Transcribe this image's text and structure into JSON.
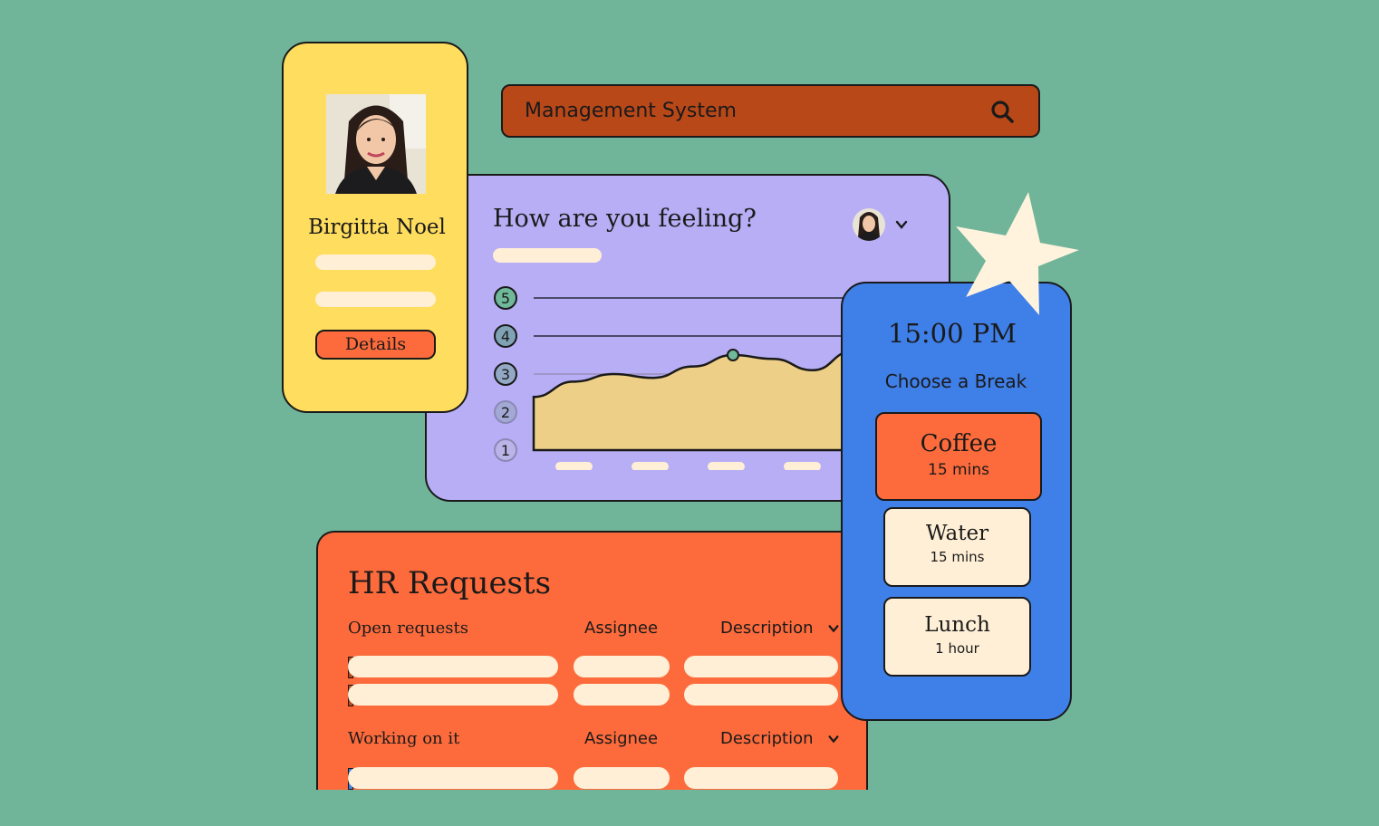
{
  "profile": {
    "name": "Birgitta Noel",
    "details_label": "Details"
  },
  "search": {
    "text": "Management System",
    "icon": "search-icon"
  },
  "mood": {
    "title": "How are you feeling?",
    "scale": [
      "5",
      "4",
      "3",
      "2",
      "1"
    ],
    "chart_data": {
      "type": "area",
      "ylim": [
        1,
        5
      ],
      "values": [
        2.4,
        2.8,
        3.0,
        2.9,
        3.2,
        3.5,
        3.4,
        3.1,
        3.6
      ],
      "highlight_value": 3.5,
      "ticks": 5
    }
  },
  "break": {
    "time": "15:00 PM",
    "subtitle": "Choose a Break",
    "options": [
      {
        "title": "Coffee",
        "duration": "15 mins",
        "selected": true
      },
      {
        "title": "Water",
        "duration": "15 mins",
        "selected": false
      },
      {
        "title": "Lunch",
        "duration": "1 hour",
        "selected": false
      }
    ]
  },
  "hr": {
    "title": "HR Requests",
    "sections": [
      {
        "label": "Open requests",
        "assignee": "Assignee",
        "description": "Description"
      },
      {
        "label": "Working on it",
        "assignee": "Assignee",
        "description": "Description"
      }
    ]
  },
  "colors": {
    "background": "#70b499",
    "profile": "#ffdd5e",
    "search": "#b94819",
    "mood": "#b7aef5",
    "break": "#3f7fe8",
    "hr": "#fd6b3c",
    "cream": "#ffefd6"
  }
}
